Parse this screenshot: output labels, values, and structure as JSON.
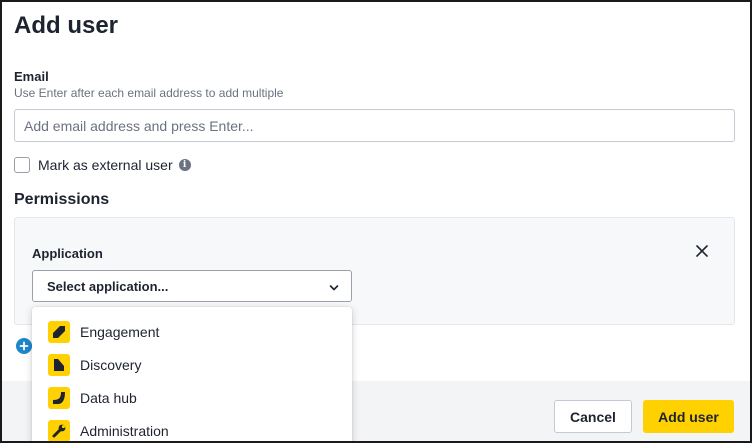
{
  "dialog": {
    "title": "Add user"
  },
  "email": {
    "label": "Email",
    "help": "Use Enter after each email address to add multiple",
    "placeholder": "Add email address and press Enter...",
    "value": ""
  },
  "external_user": {
    "label": "Mark as external user",
    "checked": false,
    "info_icon": "info-icon"
  },
  "permissions": {
    "heading": "Permissions",
    "application_label": "Application",
    "select_placeholder": "Select application...",
    "remove_icon": "close-icon",
    "add_icon": "plus-circle-icon"
  },
  "application_options": [
    {
      "label": "Engagement",
      "icon": "engagement-icon"
    },
    {
      "label": "Discovery",
      "icon": "discovery-icon"
    },
    {
      "label": "Data hub",
      "icon": "data-hub-icon"
    },
    {
      "label": "Administration",
      "icon": "wrench-icon"
    }
  ],
  "footer": {
    "cancel_label": "Cancel",
    "submit_label": "Add user"
  },
  "colors": {
    "accent": "#ffd100",
    "add_blue": "#1c87c9",
    "text": "#1e2330"
  }
}
